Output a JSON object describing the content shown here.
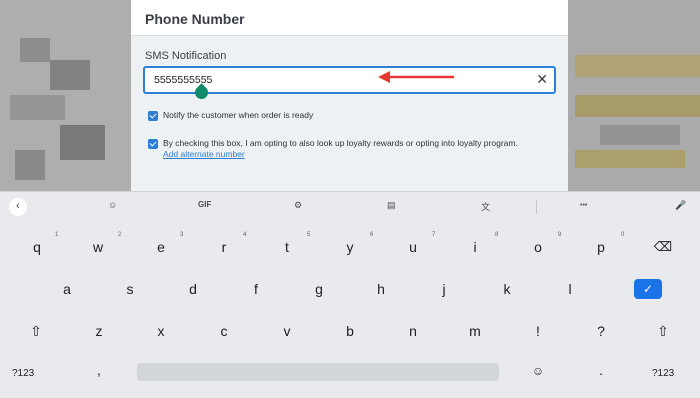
{
  "dialog": {
    "title": "Phone Number",
    "field_label": "SMS Notification",
    "phone_value": "5555555555",
    "clear_glyph": "✕",
    "notify_label": "Notify the customer when order is ready",
    "loyalty_label": "By checking this box, I am opting to also look up loyalty rewards or opting into loyalty program.",
    "alternate_link": "Add alternate number",
    "accent_color": "#2e7ed6",
    "annotation_arrow_color": "#e53935"
  },
  "keyboard": {
    "toolbar": {
      "back": "‹",
      "sticker": "☺",
      "gif": "GIF",
      "settings": "⚙",
      "clipboard": "▤",
      "translate": "文",
      "more": "•••",
      "mic": "🎤"
    },
    "row1": [
      "q",
      "w",
      "e",
      "r",
      "t",
      "y",
      "u",
      "i",
      "o",
      "p"
    ],
    "row1_digits": [
      "1",
      "2",
      "3",
      "4",
      "5",
      "6",
      "7",
      "8",
      "9",
      "0"
    ],
    "row2": [
      "a",
      "s",
      "d",
      "f",
      "g",
      "h",
      "j",
      "k",
      "l"
    ],
    "row3": [
      "z",
      "x",
      "c",
      "v",
      "b",
      "n",
      "m",
      "!",
      "?"
    ],
    "shift_glyph": "⇧",
    "backspace_glyph": "⌫",
    "enter_glyph": "✓",
    "symbols_label": "?123",
    "comma": ",",
    "emoji_glyph": "☺",
    "period": "."
  }
}
